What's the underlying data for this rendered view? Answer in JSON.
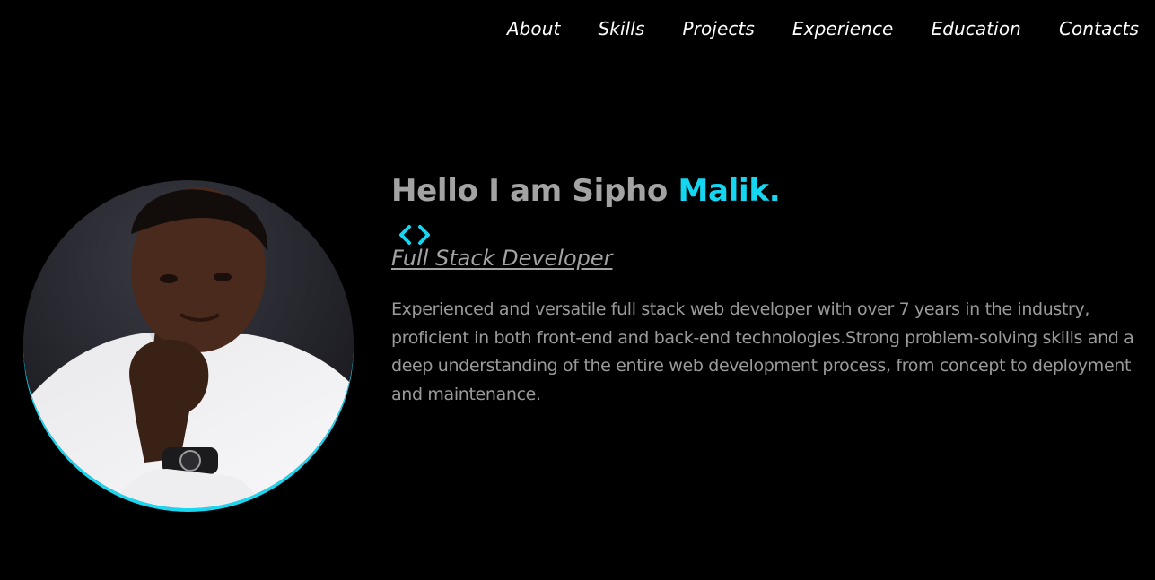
{
  "nav": {
    "items": [
      {
        "label": "About"
      },
      {
        "label": "Skills"
      },
      {
        "label": "Projects"
      },
      {
        "label": "Experience"
      },
      {
        "label": "Education"
      },
      {
        "label": "Contacts"
      }
    ]
  },
  "hero": {
    "greeting": "Hello I am Sipho ",
    "name_accent": "Malik.",
    "role": "Full Stack Developer",
    "bio": "Experienced and versatile full stack web developer with over 7 years in the industry, proficient in both front-end and back-end technologies.Strong problem-solving skills and a deep understanding of the entire web development process, from concept to deployment and maintenance."
  },
  "icons": {
    "code": "code-brackets-icon"
  },
  "colors": {
    "background": "#000000",
    "accent": "#14d6f0",
    "text_muted": "#a3a3a3",
    "nav_text": "#ffffff"
  }
}
